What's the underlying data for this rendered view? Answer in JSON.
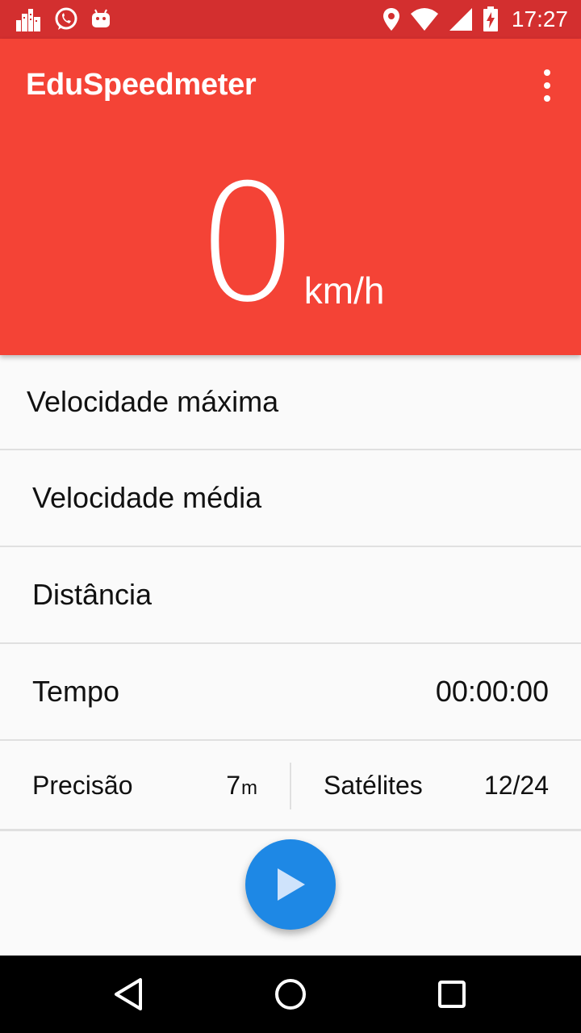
{
  "status_bar": {
    "left_icons": [
      "city-icon",
      "whatsapp-icon",
      "android-icon"
    ],
    "right_icons": [
      "location-icon",
      "wifi-icon",
      "signal-icon",
      "battery-charging-icon"
    ],
    "time": "17:27"
  },
  "app_bar": {
    "title": "EduSpeedmeter",
    "menu_icon": "more-vert-icon",
    "color": "#f44336"
  },
  "speed": {
    "value": "0",
    "unit": "km/h"
  },
  "stats": {
    "max_speed_label": "Velocidade máxima",
    "avg_speed_label": "Velocidade média",
    "distance_label": "Distância",
    "time_label": "Tempo",
    "time_value": "00:00:00"
  },
  "gps": {
    "precision_label": "Precisão",
    "precision_value": "7",
    "precision_unit": "m",
    "satellites_label": "Satélites",
    "satellites_value": "12/24"
  },
  "fab": {
    "icon": "play-icon",
    "color": "#1e88e5"
  },
  "nav_bar": {
    "buttons": [
      "back-icon",
      "home-icon",
      "recents-icon"
    ]
  }
}
